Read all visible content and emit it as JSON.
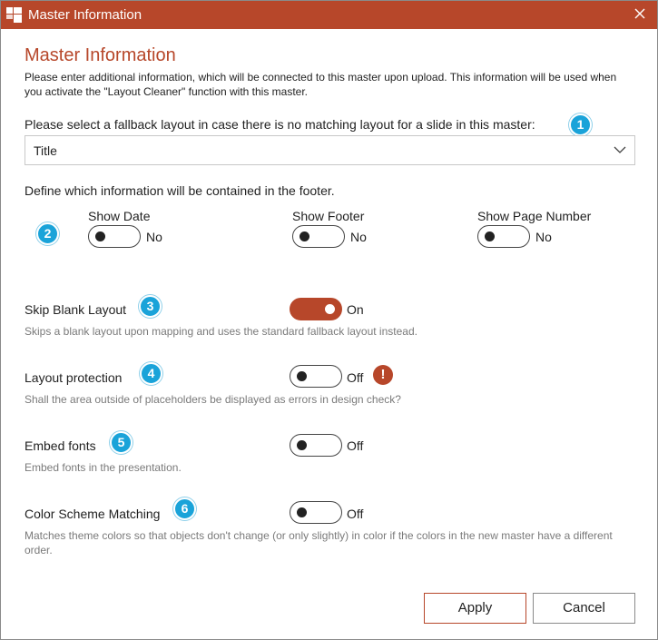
{
  "window": {
    "title": "Master Information",
    "icon": "app-logo-icon",
    "close_icon": "close-icon"
  },
  "colors": {
    "accent": "#b7472a",
    "badge": "#1aa3d9",
    "description": "#7a7a7a"
  },
  "heading": "Master Information",
  "intro": "Please enter additional information, which will be connected to this master upon upload. This information will be used when you activate the \"Layout Cleaner\" function with this master.",
  "fallback": {
    "label": "Please select a fallback layout in case there is no matching layout for a slide in this master:",
    "badge": "1",
    "selected": "Title"
  },
  "footer": {
    "label": "Define which information will be contained in the footer.",
    "badge": "2",
    "options": [
      {
        "title": "Show Date",
        "state": "No",
        "on": false
      },
      {
        "title": "Show Footer",
        "state": "No",
        "on": false
      },
      {
        "title": "Show Page Number",
        "state": "No",
        "on": false
      }
    ]
  },
  "settings": [
    {
      "title": "Skip Blank Layout",
      "badge": "3",
      "state": "On",
      "on": true,
      "description": "Skips a blank layout upon mapping and uses the standard fallback layout instead."
    },
    {
      "title": "Layout protection",
      "badge": "4",
      "state": "Off",
      "on": false,
      "warning": "!",
      "description": "Shall the area outside of placeholders be displayed as errors in design check?"
    },
    {
      "title": "Embed fonts",
      "badge": "5",
      "state": "Off",
      "on": false,
      "description": "Embed fonts in the presentation."
    },
    {
      "title": "Color Scheme Matching",
      "badge": "6",
      "state": "Off",
      "on": false,
      "description": "Matches theme colors so that objects don't change (or only slightly) in color if the colors in the new master have a different order."
    }
  ],
  "buttons": {
    "apply": "Apply",
    "cancel": "Cancel"
  }
}
